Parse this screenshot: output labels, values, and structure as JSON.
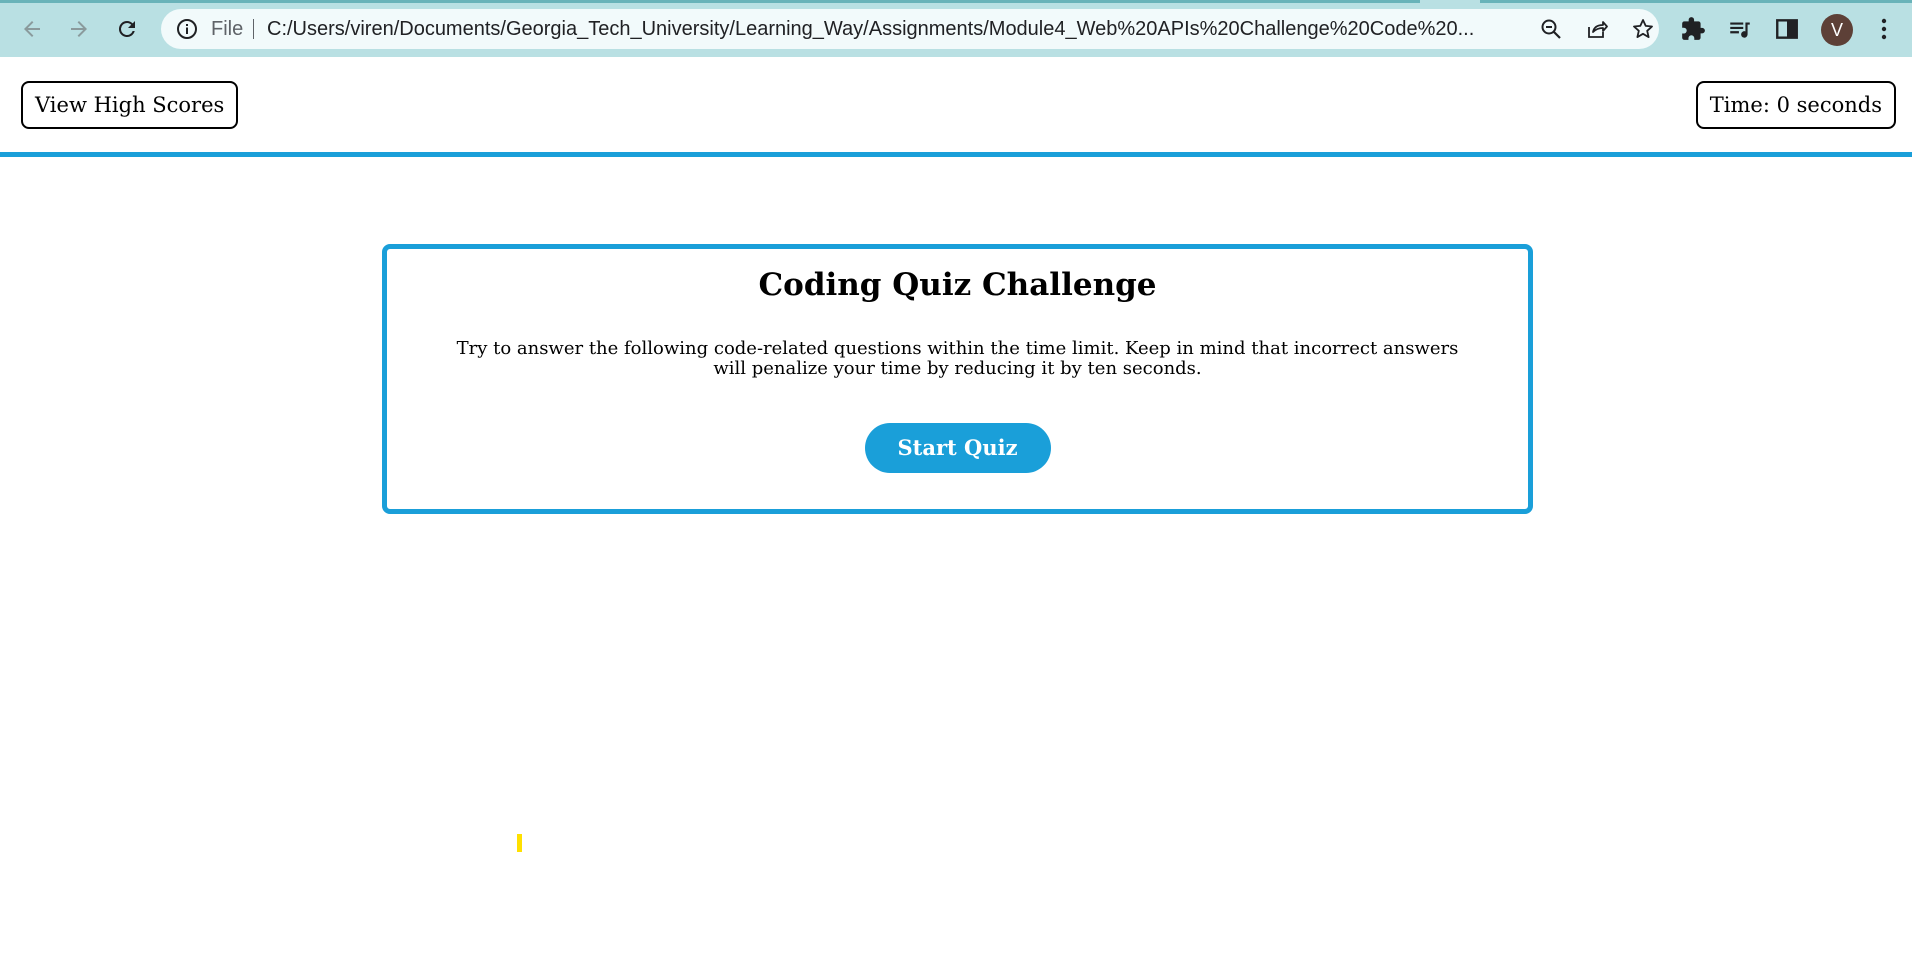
{
  "browser": {
    "address_bar": {
      "scheme_label": "File",
      "url": "C:/Users/viren/Documents/Georgia_Tech_University/Learning_Way/Assignments/Module4_Web%20APIs%20Challenge%20Code%20..."
    },
    "profile_initial": "V",
    "icons": {
      "back": "arrow-left-icon",
      "forward": "arrow-right-icon",
      "reload": "reload-icon",
      "info": "info-icon",
      "zoom": "zoom-out-icon",
      "share": "share-icon",
      "bookmark": "star-icon",
      "extensions": "puzzle-icon",
      "media": "media-queue-icon",
      "side_panel": "side-panel-icon",
      "menu": "kebab-menu-icon"
    }
  },
  "header": {
    "high_scores_label": "View High Scores",
    "timer_label": "Time: 0 seconds"
  },
  "quiz": {
    "title": "Coding Quiz Challenge",
    "description": "Try to answer the following code-related questions within the time limit. Keep in mind that incorrect answers will penalize your time by reducing it by ten seconds.",
    "start_label": "Start Quiz"
  },
  "colors": {
    "accent": "#1a9fd9",
    "chrome_background": "#b9e0e3",
    "cursor_highlight": "#ffe000"
  }
}
